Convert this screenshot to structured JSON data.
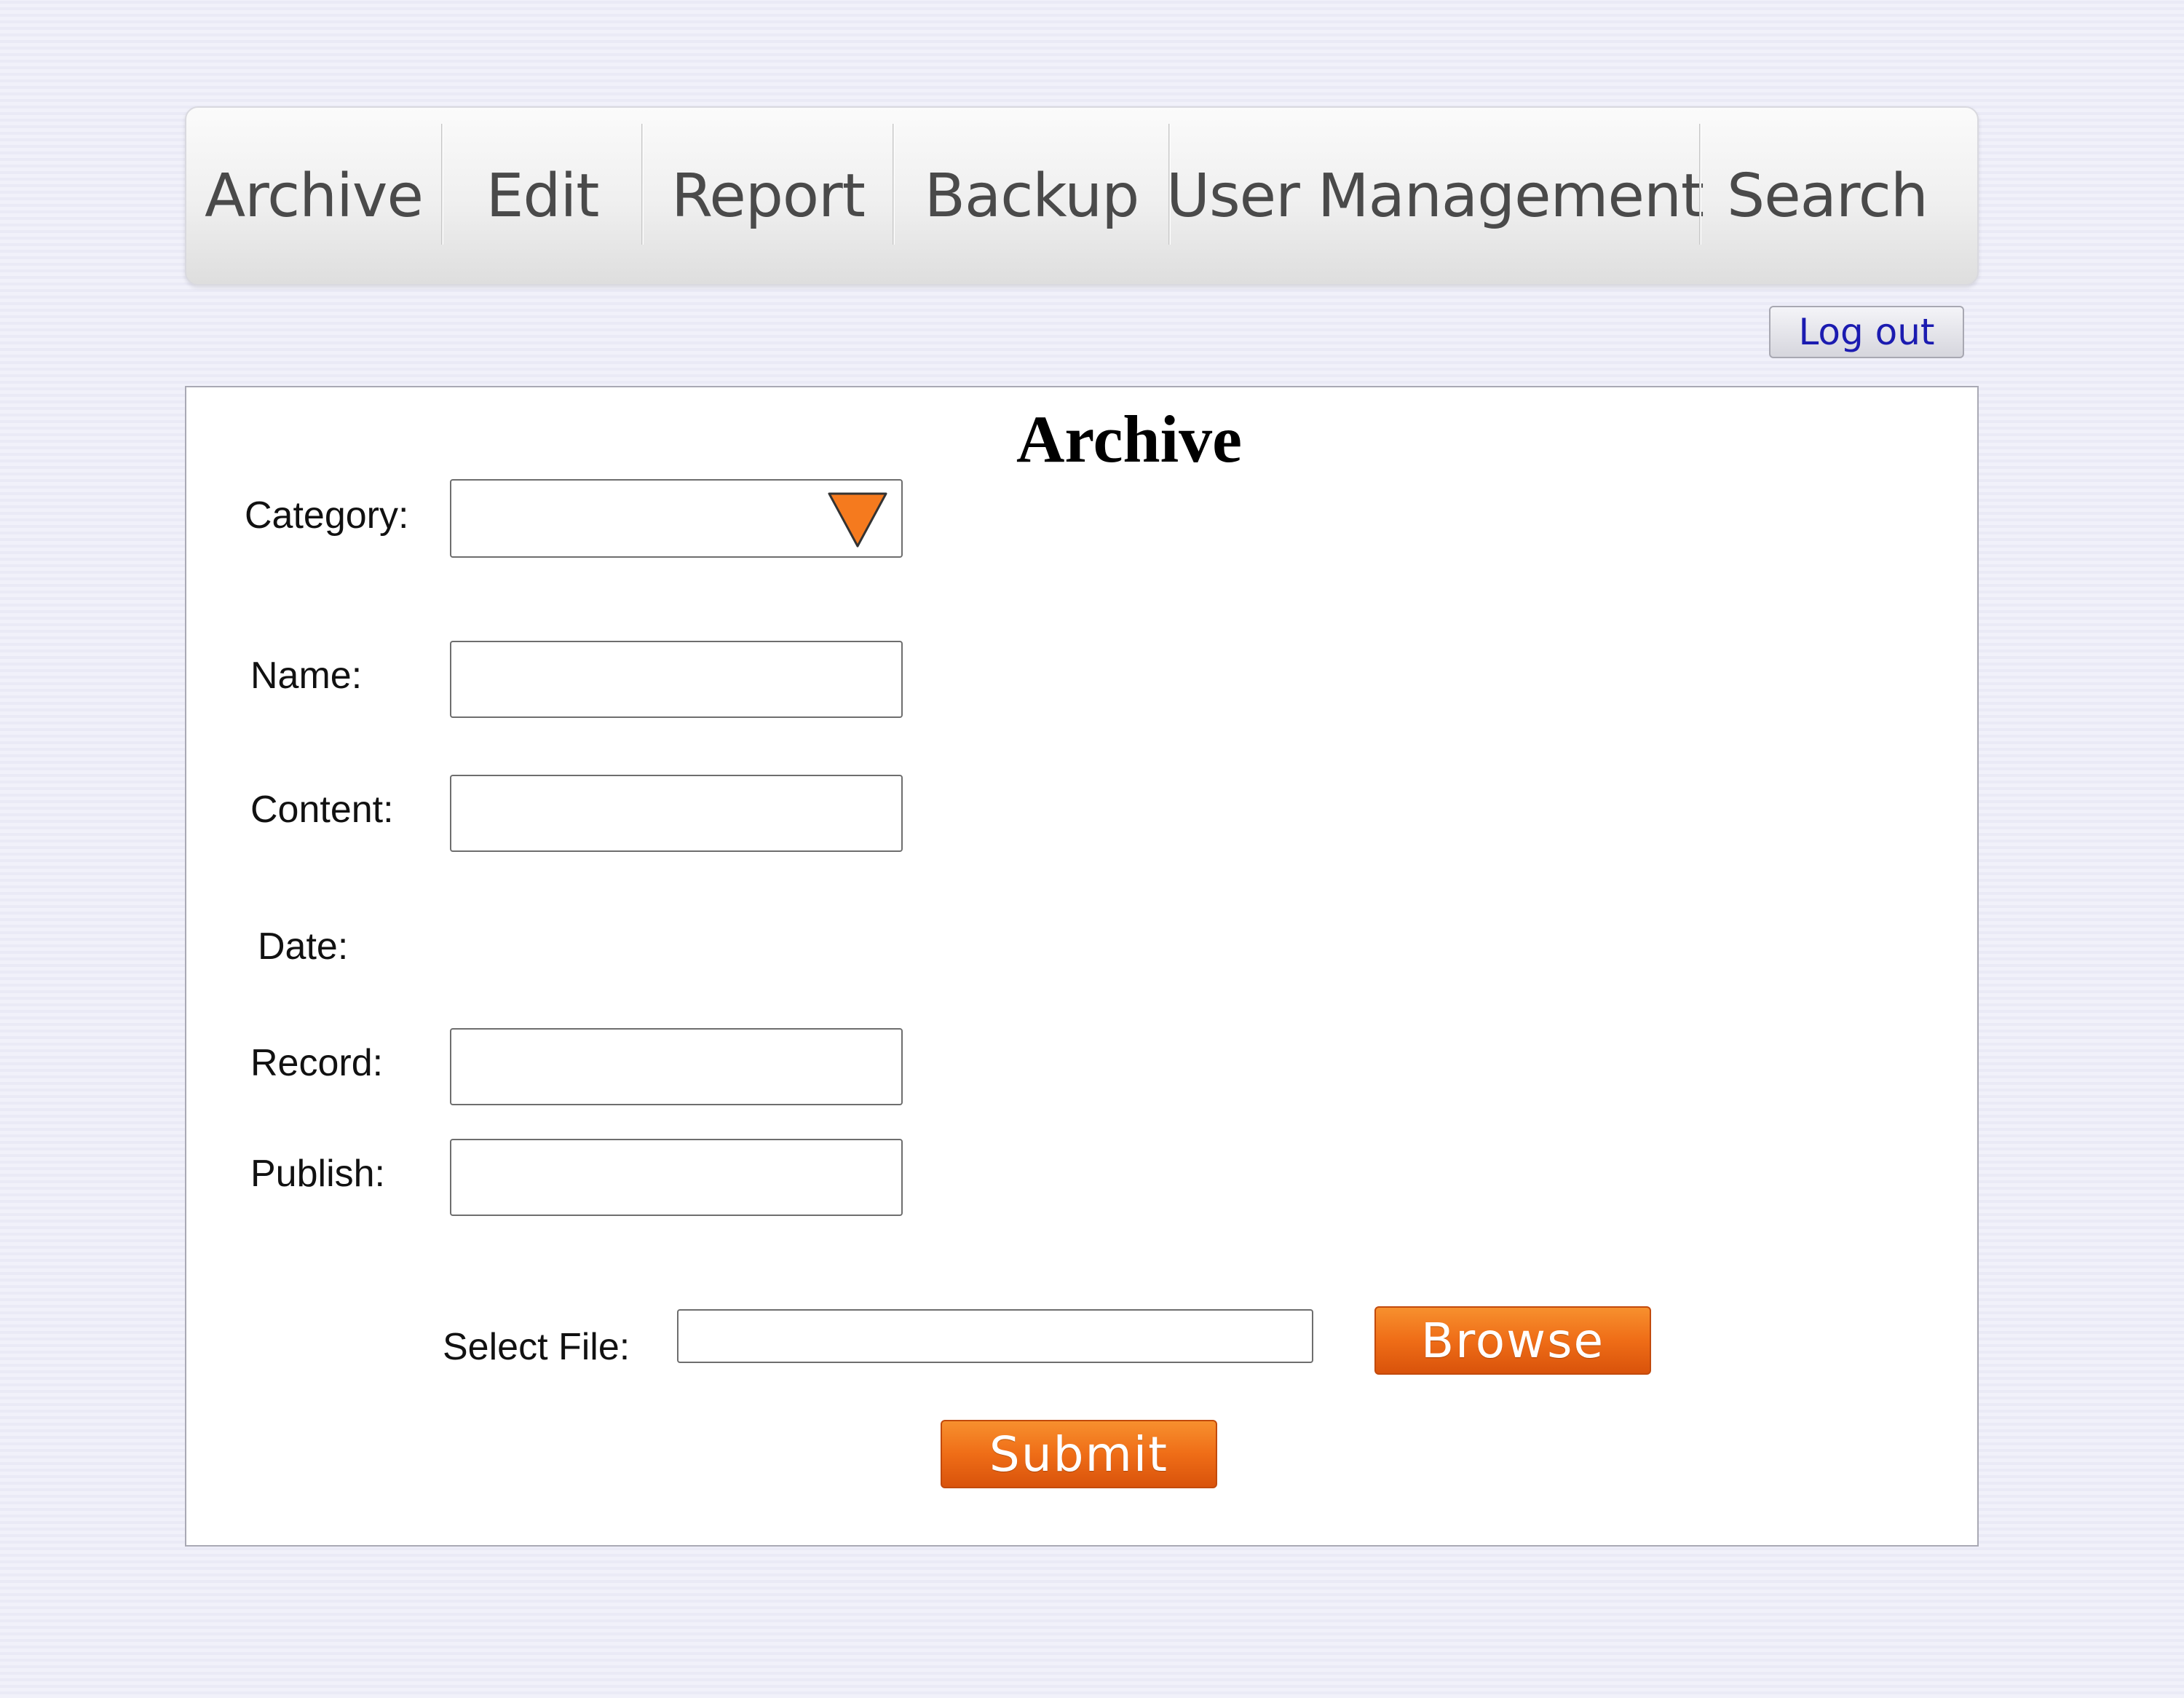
{
  "nav": {
    "items": [
      {
        "label": "Archive"
      },
      {
        "label": "Edit"
      },
      {
        "label": "Report"
      },
      {
        "label": "Backup"
      },
      {
        "label": "User Management"
      },
      {
        "label": "Search"
      }
    ]
  },
  "logout_label": "Log out",
  "form": {
    "title": "Archive",
    "category": {
      "label": "Category:",
      "value": ""
    },
    "name": {
      "label": "Name:",
      "value": ""
    },
    "content": {
      "label": "Content:",
      "value": ""
    },
    "date": {
      "label": "Date:"
    },
    "record": {
      "label": "Record:",
      "value": ""
    },
    "publish": {
      "label": "Publish:",
      "value": ""
    },
    "select_file": {
      "label": "Select File:",
      "value": ""
    },
    "browse_label": "Browse",
    "submit_label": "Submit"
  },
  "colors": {
    "accent": "#ef6d17",
    "link": "#1b1bb0"
  },
  "icons": {
    "category_dropdown": "triangle-down-icon"
  }
}
